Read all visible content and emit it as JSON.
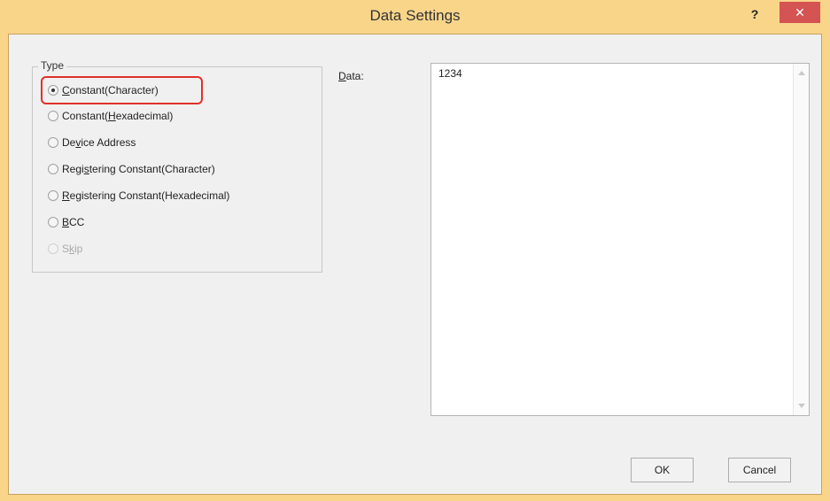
{
  "window": {
    "title": "Data Settings",
    "help_label": "?",
    "close_label": "✕"
  },
  "type_group": {
    "legend": "Type",
    "options": [
      {
        "pre": "",
        "key": "C",
        "post": "onstant(Character)",
        "checked": true,
        "enabled": true
      },
      {
        "pre": "Constant(",
        "key": "H",
        "post": "exadecimal)",
        "checked": false,
        "enabled": true
      },
      {
        "pre": "De",
        "key": "v",
        "post": "ice Address",
        "checked": false,
        "enabled": true
      },
      {
        "pre": "Regi",
        "key": "s",
        "post": "tering Constant(Character)",
        "checked": false,
        "enabled": true
      },
      {
        "pre": "",
        "key": "R",
        "post": "egistering Constant(Hexadecimal)",
        "checked": false,
        "enabled": true
      },
      {
        "pre": "",
        "key": "B",
        "post": "CC",
        "checked": false,
        "enabled": true
      },
      {
        "pre": "S",
        "key": "k",
        "post": "ip",
        "checked": false,
        "enabled": false
      }
    ]
  },
  "data_field": {
    "label_key": "D",
    "label_rest": "ata:",
    "value": "1234"
  },
  "buttons": {
    "ok": "OK",
    "cancel": "Cancel"
  },
  "colors": {
    "title_bar": "#f9d58a",
    "close_button": "#d45353",
    "highlight": "#e0302a"
  }
}
